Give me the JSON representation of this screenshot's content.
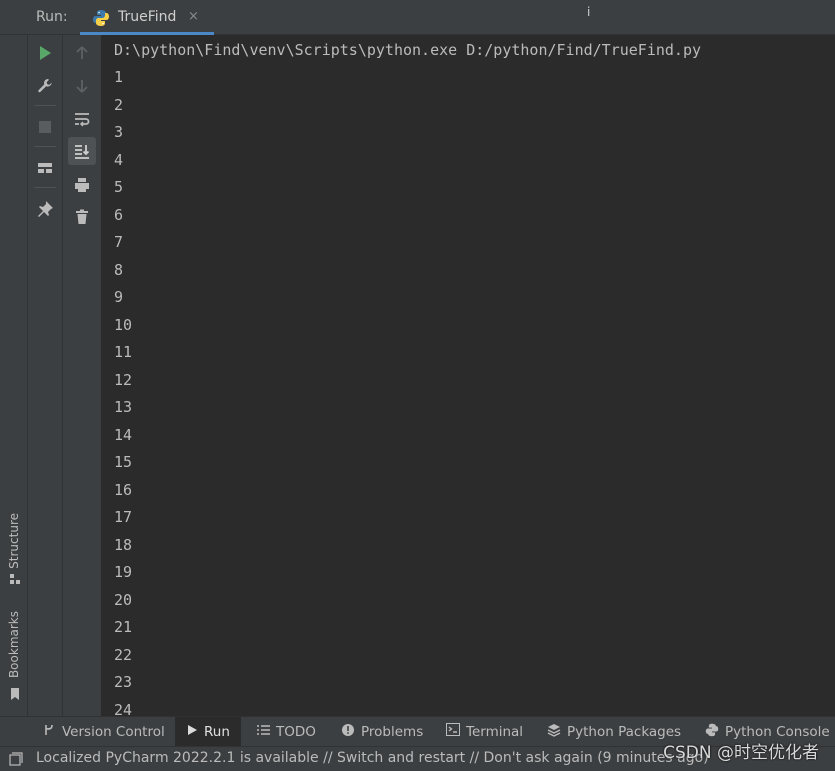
{
  "header": {
    "run_label": "Run:",
    "tab_name": "TrueFind",
    "tab_close": "×",
    "cursor_glyph": "i"
  },
  "left_stripe": {
    "structure_label": "Structure",
    "bookmarks_label": "Bookmarks"
  },
  "console": {
    "command": "D:\\python\\Find\\venv\\Scripts\\python.exe D:/python/Find/TrueFind.py",
    "output_lines": [
      "1",
      "2",
      "3",
      "4",
      "5",
      "6",
      "7",
      "8",
      "9",
      "10",
      "11",
      "12",
      "13",
      "14",
      "15",
      "16",
      "17",
      "18",
      "19",
      "20",
      "21",
      "22",
      "23",
      "24"
    ]
  },
  "tool_windows": {
    "version_control": "Version Control",
    "run": "Run",
    "todo": "TODO",
    "problems": "Problems",
    "terminal": "Terminal",
    "python_packages": "Python Packages",
    "python_console": "Python Console"
  },
  "status": {
    "message": "Localized PyCharm 2022.2.1 is available // Switch and restart // Don't ask again (9 minutes ago)"
  },
  "watermark": "CSDN @时空优化者",
  "colors": {
    "background": "#2b2b2b",
    "panel": "#3c3f41",
    "accent_tab": "#4a88c7",
    "run_green": "#59a869"
  }
}
